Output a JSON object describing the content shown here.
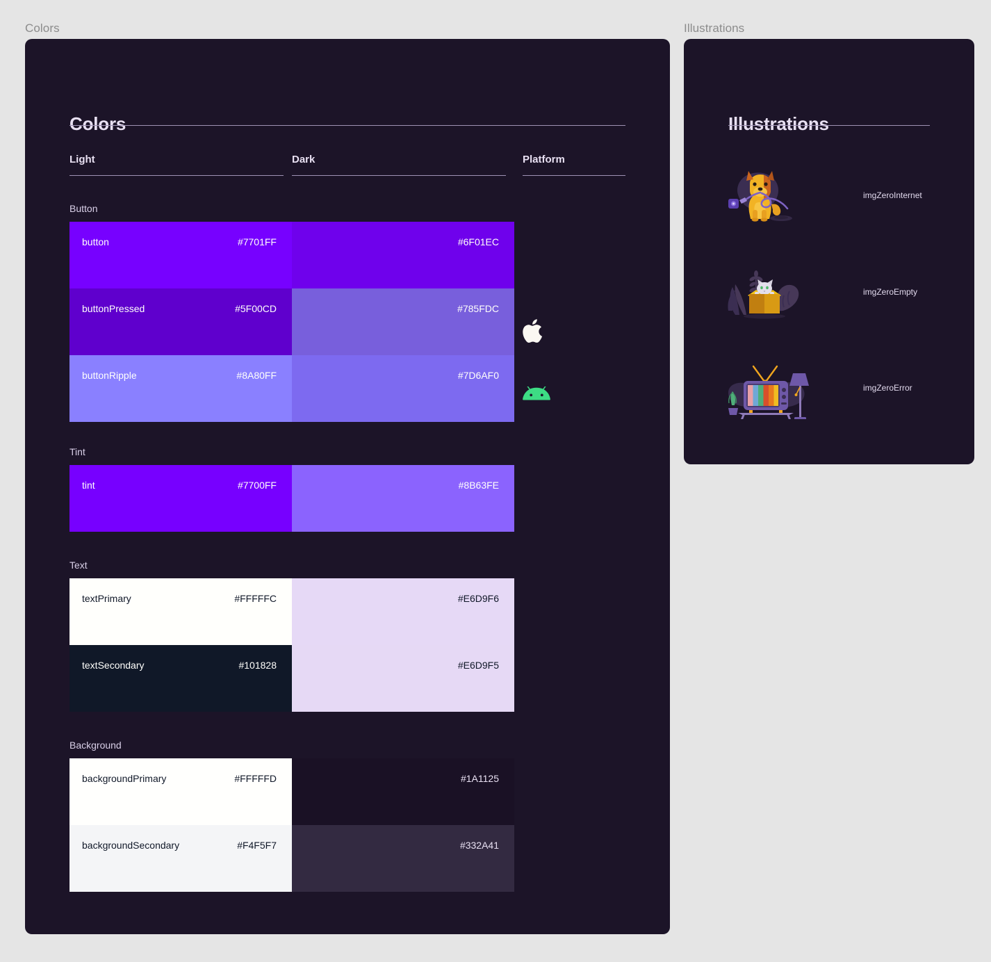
{
  "canvas": {
    "frames": [
      {
        "label": "Colors"
      },
      {
        "label": "Illustrations"
      }
    ]
  },
  "colors_card": {
    "title": "Colors",
    "columns": [
      {
        "label": "Light"
      },
      {
        "label": "Dark"
      },
      {
        "label": "Platform"
      }
    ],
    "platform_icons": [
      {
        "name": "apple-logo",
        "color": "#FAF7F2"
      },
      {
        "name": "android-logo",
        "color": "#3DDC84"
      }
    ],
    "groups": [
      {
        "label": "Button",
        "rows": [
          {
            "light": {
              "name": "button",
              "hex": "#7701FF",
              "swatch": "#7701FF",
              "text": "#FFFFFC"
            },
            "dark": {
              "name": "",
              "hex": "#6F01EC",
              "swatch": "#6F01EC",
              "text": "#FFFFFC"
            }
          },
          {
            "light": {
              "name": "buttonPressed",
              "hex": "#5F00CD",
              "swatch": "#5F00CD",
              "text": "#FFFFFC"
            },
            "dark": {
              "name": "",
              "hex": "#785FDC",
              "swatch": "#785FDC",
              "text": "#FFFFFC"
            }
          },
          {
            "light": {
              "name": "buttonRipple",
              "hex": "#8A80FF",
              "swatch": "#8A80FF",
              "text": "#FFFFFC"
            },
            "dark": {
              "name": "",
              "hex": "#7D6AF0",
              "swatch": "#7D6AF0",
              "text": "#FFFFFC"
            }
          }
        ]
      },
      {
        "label": "Tint",
        "rows": [
          {
            "light": {
              "name": "tint",
              "hex": "#7700FF",
              "swatch": "#7700FF",
              "text": "#FFFFFC"
            },
            "dark": {
              "name": "",
              "hex": "#8B63FE",
              "swatch": "#8B63FE",
              "text": "#FFFFFC"
            }
          }
        ]
      },
      {
        "label": "Text",
        "rows": [
          {
            "light": {
              "name": "textPrimary",
              "hex": "#FFFFFC",
              "swatch": "#FFFFFC",
              "text": "#101828"
            },
            "dark": {
              "name": "",
              "hex": "#E6D9F6",
              "swatch": "#E6D9F6",
              "text": "#101828"
            }
          },
          {
            "light": {
              "name": "textSecondary",
              "hex": "#101828",
              "swatch": "#101828",
              "text": "#FFFFFC"
            },
            "dark": {
              "name": "",
              "hex": "#E6D9F5",
              "swatch": "#E6D9F5",
              "text": "#101828"
            }
          }
        ]
      },
      {
        "label": "Background",
        "rows": [
          {
            "light": {
              "name": "backgroundPrimary",
              "hex": "#FFFFFD",
              "swatch": "#FFFFFD",
              "text": "#101828"
            },
            "dark": {
              "name": "",
              "hex": "#1A1125",
              "swatch": "#1A1125",
              "text": "#E8E0F2"
            }
          },
          {
            "light": {
              "name": "backgroundSecondary",
              "hex": "#F4F5F7",
              "swatch": "#F4F5F7",
              "text": "#101828"
            },
            "dark": {
              "name": "",
              "hex": "#332A41",
              "swatch": "#332A41",
              "text": "#E8E0F2"
            }
          }
        ]
      }
    ]
  },
  "illustrations_card": {
    "title": "Illustrations",
    "items": [
      {
        "label": "imgZeroInternet",
        "art": "dog-chewing-cable"
      },
      {
        "label": "imgZeroEmpty",
        "art": "cat-in-box"
      },
      {
        "label": "imgZeroError",
        "art": "retro-tv"
      }
    ]
  }
}
